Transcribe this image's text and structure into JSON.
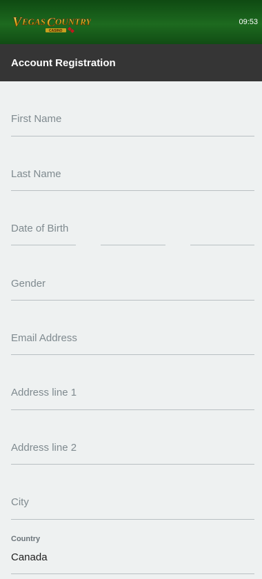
{
  "header": {
    "logo_text": "VEGAS COUNTRY",
    "logo_subtext": "CASINO",
    "time": "09:53"
  },
  "page": {
    "title": "Account Registration"
  },
  "form": {
    "first_name": "First Name",
    "last_name": "Last Name",
    "dob": "Date of Birth",
    "gender": "Gender",
    "email": "Email Address",
    "address1": "Address line 1",
    "address2": "Address line 2",
    "city": "City",
    "country_label": "Country",
    "country_value": "Canada"
  },
  "colors": {
    "header_green": "#1d6a1f",
    "title_bar": "#353535",
    "background": "#eef1f1",
    "placeholder": "#7f8a8f"
  }
}
